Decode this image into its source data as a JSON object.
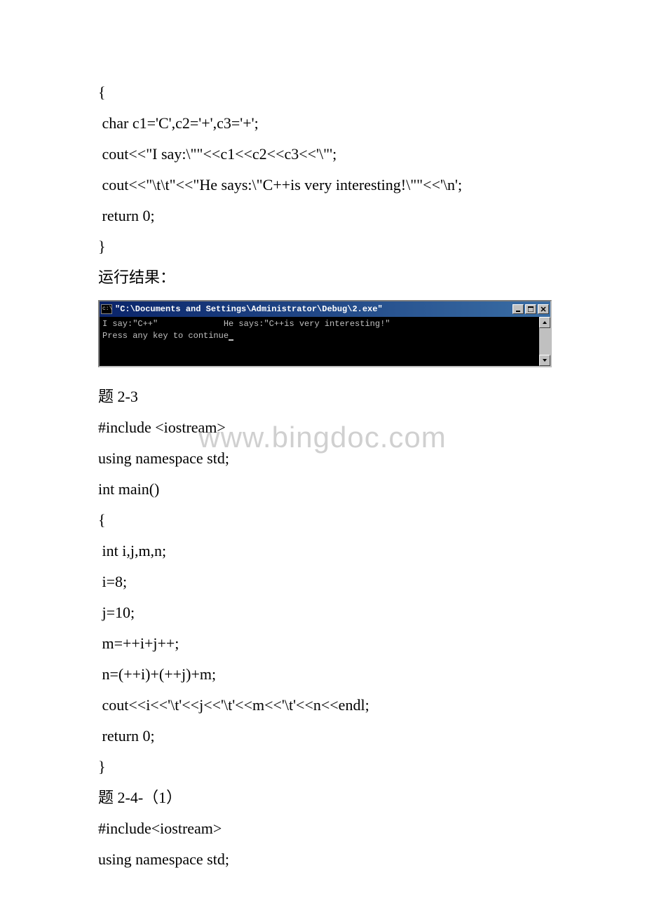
{
  "block1": {
    "lines": [
      "{",
      " char c1='C',c2='+',c3='+';",
      " cout<<\"I say:\\\"\"<<c1<<c2<<c3<<'\\\"';",
      " cout<<\"\\t\\t\"<<\"He says:\\\"C++is very interesting!\\\"\"<<'\\n';",
      " return 0;",
      "}"
    ],
    "result_label": "运行结果："
  },
  "console": {
    "title": "\"C:\\Documents and Settings\\Administrator\\Debug\\2.exe\"",
    "line1": "I say:\"C++\"             He says:\"C++is very interesting!\"",
    "line2": "Press any key to continue"
  },
  "block2": {
    "heading": "题 2-3",
    "lines": [
      "#include <iostream>",
      "using namespace std;",
      "int main()",
      "{",
      " int i,j,m,n;",
      " i=8;",
      " j=10;",
      " m=++i+j++;",
      " n=(++i)+(++j)+m;",
      " cout<<i<<'\\t'<<j<<'\\t'<<m<<'\\t'<<n<<endl;",
      " return 0;",
      "}"
    ]
  },
  "block3": {
    "heading": "题 2-4-（1）",
    "lines": [
      "#include<iostream>",
      "using namespace std;"
    ]
  },
  "watermark": "www.bingdoc.com"
}
